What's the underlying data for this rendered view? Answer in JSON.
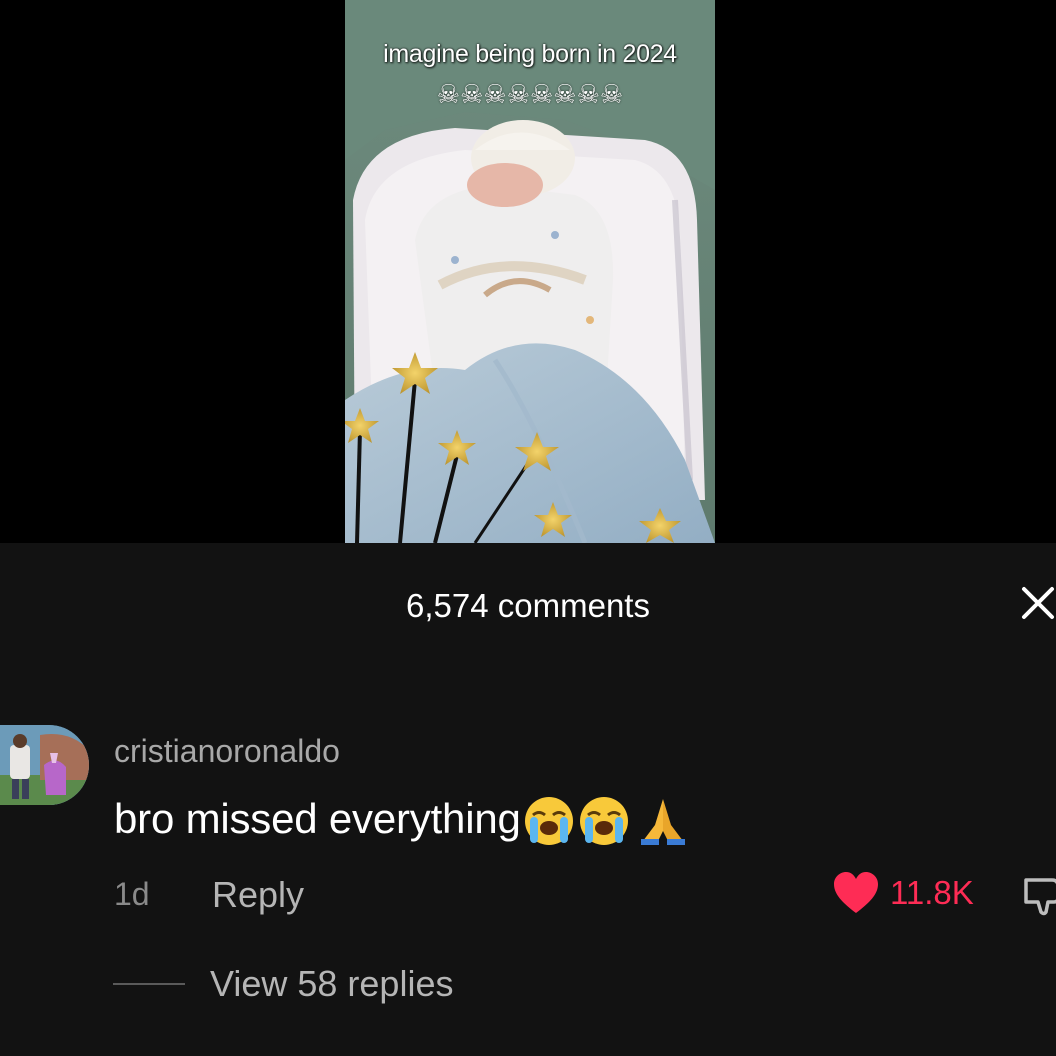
{
  "video": {
    "caption": "imagine being born in 2024",
    "caption_emojis": "☠☠☠☠☠☠☠☠"
  },
  "comments": {
    "count_label": "6,574 comments",
    "close_icon": "close-icon",
    "items": [
      {
        "username": "cristianoronaldo",
        "text": "bro missed everything",
        "emojis": [
          "loudly-crying-face",
          "loudly-crying-face",
          "folded-hands"
        ],
        "time": "1d",
        "reply_label": "Reply",
        "likes": "11.8K",
        "liked": true,
        "like_color": "#fe2c55",
        "view_replies_label": "View 58 replies"
      }
    ]
  }
}
